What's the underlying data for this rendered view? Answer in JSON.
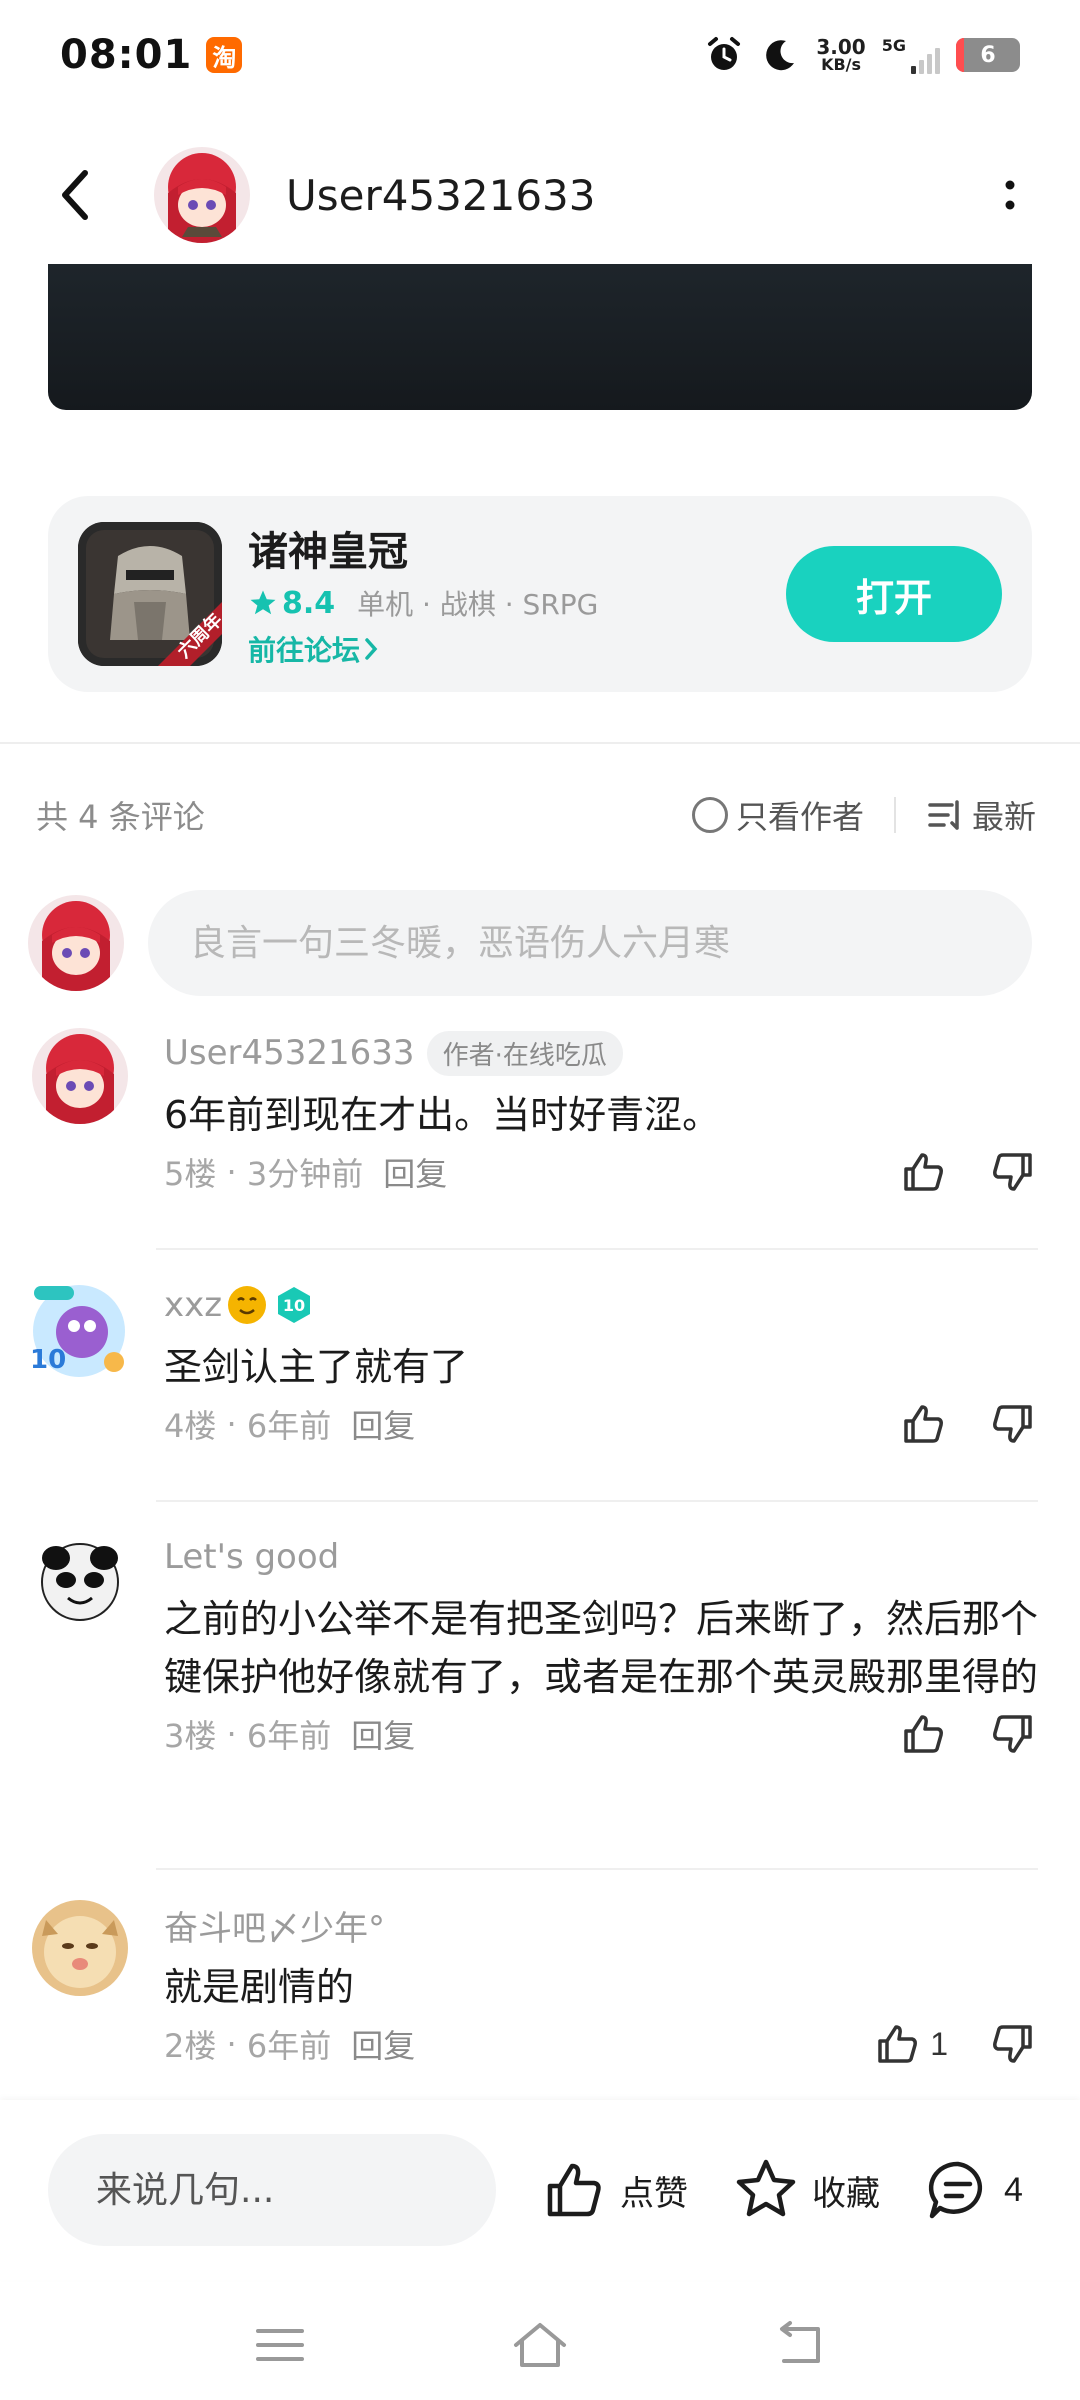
{
  "status": {
    "time": "08:01",
    "app_badge": "淘",
    "net_speed_value": "3.00",
    "net_speed_unit": "KB/s",
    "network": "5G",
    "battery": "6"
  },
  "header": {
    "username": "User45321633"
  },
  "game": {
    "title": "诸神皇冠",
    "rating": "8.4",
    "tags": "单机 · 战棋 · SRPG",
    "forum_link": "前往论坛",
    "open_label": "打开",
    "icon_ribbon": "六周年"
  },
  "comments_header": {
    "count": "共 4 条评论",
    "author_only": "只看作者",
    "sort": "最新"
  },
  "input": {
    "placeholder": "良言一句三冬暖，恶语伤人六月寒"
  },
  "comments": [
    {
      "name": "User45321633",
      "tag": "作者·在线吃瓜",
      "text": "6年前到现在才出。当时好青涩。",
      "floor": "5楼",
      "time": "3分钟前",
      "reply": "回复",
      "likes": ""
    },
    {
      "name": "xxz",
      "level": "10",
      "text": "圣剑认主了就有了",
      "floor": "4楼",
      "time": "6年前",
      "reply": "回复",
      "likes": ""
    },
    {
      "name": "Let's good",
      "text": "之前的小公举不是有把圣剑吗？后来断了，然后那个键保护他好像就有了，或者是在那个英灵殿那里得的",
      "floor": "3楼",
      "time": "6年前",
      "reply": "回复",
      "likes": ""
    },
    {
      "name": "奋斗吧〆少年°",
      "text": "就是剧情的",
      "floor": "2楼",
      "time": "6年前",
      "reply": "回复",
      "likes": "1"
    }
  ],
  "bottom_bar": {
    "placeholder": "来说几句...",
    "like_label": "点赞",
    "favorite_label": "收藏",
    "comment_count": "4"
  },
  "colors": {
    "accent": "#19d2bf",
    "accent_text": "#16b7a6"
  }
}
